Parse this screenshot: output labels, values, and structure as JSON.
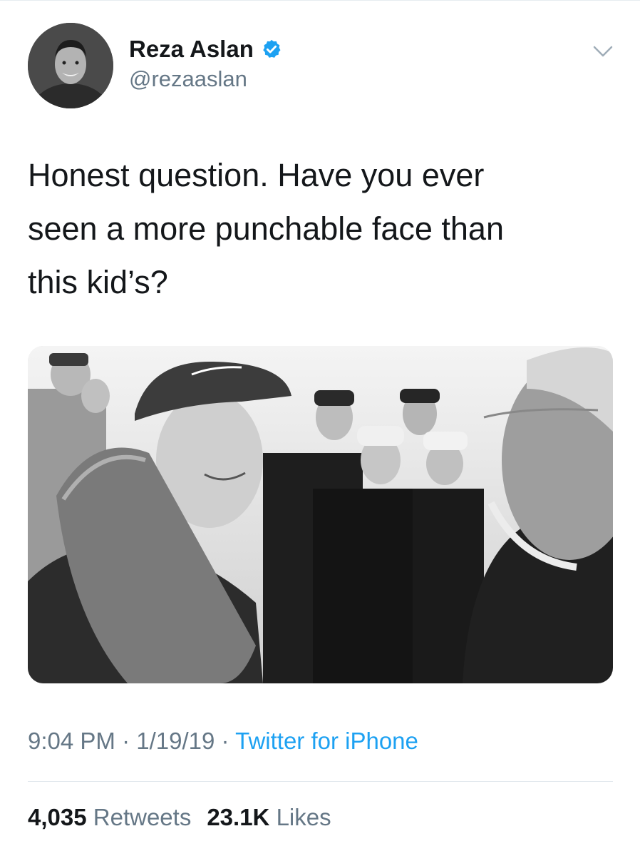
{
  "author": {
    "name": "Reza Aslan",
    "handle": "@rezaaslan",
    "verified": true
  },
  "tweet": {
    "text_lines": [
      "Honest question. Have you ever",
      "seen a more punchable face than",
      "this kid’s?"
    ]
  },
  "meta": {
    "time": "9:04 PM",
    "date": "1/19/19",
    "separator": "·",
    "source": "Twitter for iPhone"
  },
  "stats": {
    "retweets_count": "4,035",
    "retweets_label": "Retweets",
    "likes_count": "23.1K",
    "likes_label": "Likes"
  },
  "icons": {
    "verified": "verified-badge-icon",
    "menu": "chevron-down-icon"
  },
  "colors": {
    "link": "#1da1f2",
    "secondary_text": "#657786",
    "primary_text": "#14171a"
  }
}
